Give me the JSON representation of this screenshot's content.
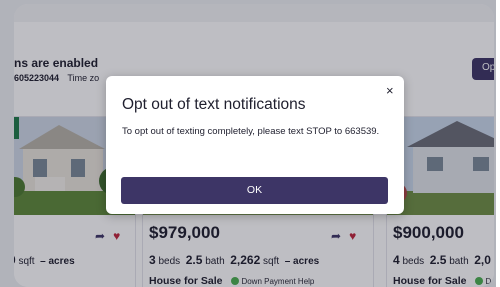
{
  "notification": {
    "title": "ns are enabled",
    "phone": "605223044",
    "timezone": "Time zo"
  },
  "opt_button": {
    "label": "Op"
  },
  "listings": [
    {
      "area": "0",
      "sqft_unit": "sqft",
      "acres": "– acres"
    },
    {
      "price": "$979,000",
      "beds": "3",
      "beds_label": "beds",
      "baths": "2.5",
      "baths_label": "bath",
      "sqft": "2,262",
      "sqft_unit": "sqft",
      "acres": "– acres",
      "status": "House for Sale",
      "badge": "Down Payment Help"
    },
    {
      "price": "$900,000",
      "beds": "4",
      "beds_label": "beds",
      "baths": "2.5",
      "baths_label": "bath",
      "sqft": "2,0",
      "status": "House for Sale",
      "badge": "D"
    }
  ],
  "modal": {
    "title": "Opt out of text notifications",
    "body": "To opt out of texting completely, please text STOP to 663539.",
    "ok_label": "OK",
    "close_icon": "×"
  },
  "colors": {
    "primary": "#3d3566",
    "heart": "#c0243b",
    "badge_green": "#4caf50"
  }
}
